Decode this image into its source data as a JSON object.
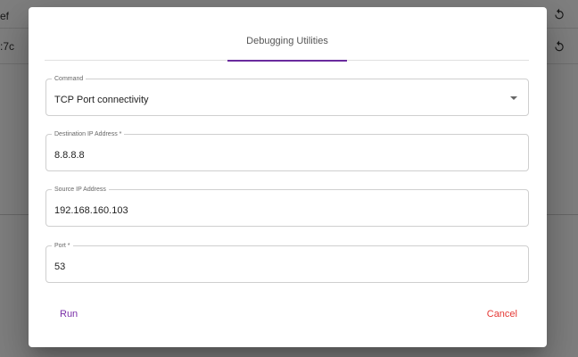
{
  "background": {
    "rows": [
      {
        "text": "ef",
        "icon": "refresh-icon"
      },
      {
        "text": ":7c",
        "icon": "refresh-icon"
      }
    ]
  },
  "dialog": {
    "tabs": [
      {
        "label": "Debugging Utilities",
        "active": true
      }
    ],
    "fields": {
      "command": {
        "label": "Command",
        "value": "TCP Port connectivity"
      },
      "destination_ip": {
        "label": "Destination IP Address *",
        "value": "8.8.8.8"
      },
      "source_ip": {
        "label": "Source IP Address",
        "value": "192.168.160.103"
      },
      "port": {
        "label": "Port *",
        "value": "53"
      }
    },
    "actions": {
      "run_label": "Run",
      "cancel_label": "Cancel"
    }
  },
  "colors": {
    "accent": "#6a2b9e",
    "run": "#7a2fa8",
    "cancel": "#e53935",
    "overlay": "rgba(0,0,0,0.5)"
  }
}
